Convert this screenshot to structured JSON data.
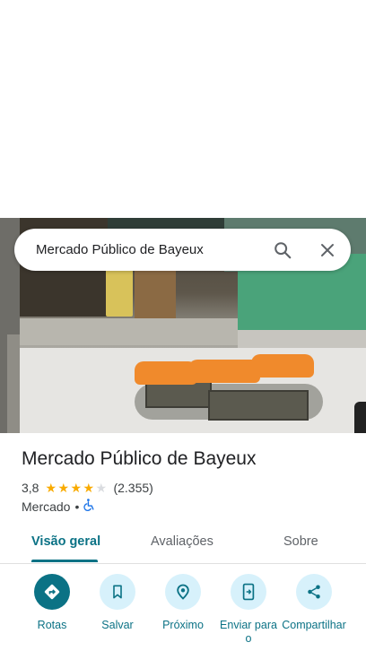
{
  "search": {
    "query": "Mercado Público de Bayeux"
  },
  "place": {
    "title": "Mercado Público de Bayeux",
    "rating": "3,8",
    "rating_value": 3.8,
    "stars_filled": 4,
    "stars_total": 5,
    "review_count": "(2.355)",
    "category": "Mercado",
    "separator": "•"
  },
  "tabs": [
    {
      "label": "Visão geral",
      "active": true
    },
    {
      "label": "Avaliações",
      "active": false
    },
    {
      "label": "Sobre",
      "active": false
    }
  ],
  "actions": [
    {
      "label": "Rotas",
      "icon": "directions-icon"
    },
    {
      "label": "Salvar",
      "icon": "bookmark-icon"
    },
    {
      "label": "Próximo",
      "icon": "nearby-icon"
    },
    {
      "label": "Enviar para o",
      "icon": "send-to-phone-icon"
    },
    {
      "label": "Compartilhar",
      "icon": "share-icon"
    }
  ],
  "colors": {
    "accent": "#0b7285",
    "action_bg": "#d7f1fb",
    "star": "#f9ab00",
    "accessibility": "#1a73e8"
  }
}
